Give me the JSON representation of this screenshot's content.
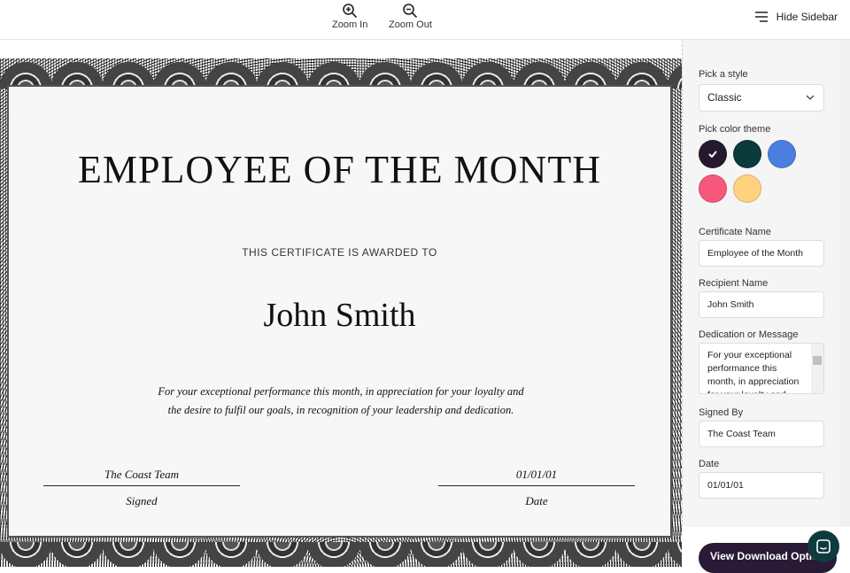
{
  "toolbar": {
    "zoom_in": "Zoom In",
    "zoom_out": "Zoom Out",
    "hide_sidebar": "Hide Sidebar"
  },
  "certificate": {
    "title": "EMPLOYEE OF THE MONTH",
    "awarded": "THIS CERTIFICATE IS AWARDED TO",
    "recipient": "John Smith",
    "message": "For your exceptional performance this month, in appreciation for your loyalty and the desire to fulfil our goals, in recognition of your leadership and dedication.",
    "signed_value": "The Coast Team",
    "signed_label": "Signed",
    "date_value": "01/01/01",
    "date_label": "Date"
  },
  "sidebar": {
    "style_label": "Pick a style",
    "style_value": "Classic",
    "color_label": "Pick color theme",
    "colors": [
      "#24192f",
      "#0b3a3c",
      "#4a7fe0",
      "#f5587a",
      "#ffd27f"
    ],
    "selected_color": "#24192f",
    "cert_name_label": "Certificate Name",
    "cert_name": "Employee of the Month",
    "recipient_label": "Recipient Name",
    "recipient": "John Smith",
    "message_label": "Dedication or Message",
    "message": "For your exceptional performance this month, in appreciation for your loyalty and",
    "signed_label": "Signed By",
    "signed": "The Coast Team",
    "date_label": "Date",
    "date": "01/01/01"
  },
  "footer": {
    "download": "View Download Options"
  }
}
